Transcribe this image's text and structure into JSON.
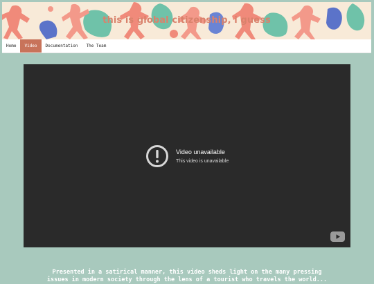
{
  "site": {
    "title": "this is global citizenship, i guess"
  },
  "nav": {
    "items": [
      {
        "label": "Home",
        "active": false
      },
      {
        "label": "Video",
        "active": true
      },
      {
        "label": "Documentation",
        "active": false
      },
      {
        "label": "The Team",
        "active": false
      }
    ]
  },
  "video": {
    "error_title": "Video unavailable",
    "error_subtitle": "This video is unavailable",
    "icons": [
      "alert-circle-icon",
      "youtube-logo-icon"
    ]
  },
  "description": {
    "line1": "Presented in a satirical manner, this video sheds light on the many pressing",
    "line2": "issues in modern society through the lens of a tourist who travels the world..."
  },
  "colors": {
    "background": "#a8c9bd",
    "banner_bg": "#f8ead8",
    "title_color": "#d9826c",
    "nav_active": "#c8735a",
    "video_bg": "#2a2a2a"
  }
}
